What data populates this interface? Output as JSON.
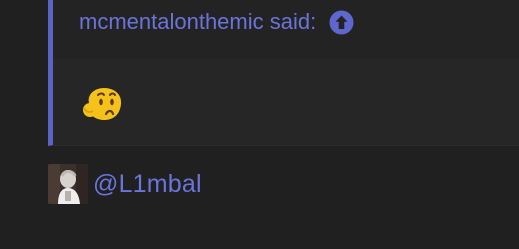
{
  "quote": {
    "author": "mcmentalonthemic",
    "said_label": "said:",
    "jump_icon": "arrow-up-circle-icon",
    "body_emoji": "thinking-face-emoji"
  },
  "mention": {
    "text": "@L1mbal",
    "avatar_icon": "user-avatar"
  },
  "colors": {
    "accent": "#5b63c6",
    "link": "#6b74db",
    "background": "#202020",
    "quote_background": "#232323",
    "emoji_yellow": "#f4c21a"
  }
}
